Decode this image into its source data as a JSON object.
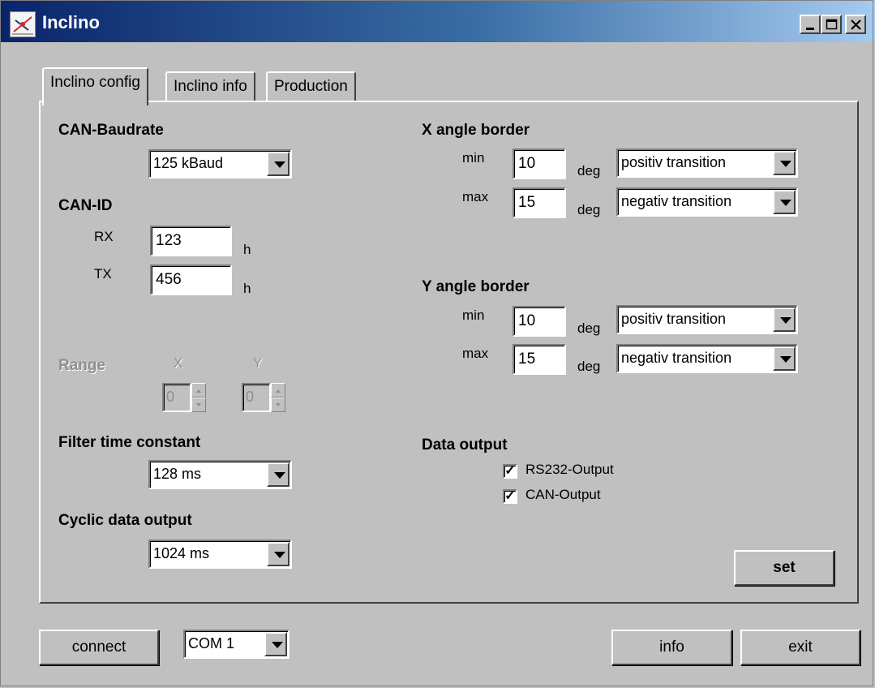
{
  "window": {
    "title": "Inclino",
    "app_icon": "inclino-logo-icon",
    "controls": [
      "minimize-icon",
      "maximize-icon",
      "close-icon"
    ]
  },
  "tabs": [
    {
      "label": "Inclino config",
      "active": true
    },
    {
      "label": "Inclino info",
      "active": false
    },
    {
      "label": "Production",
      "active": false
    }
  ],
  "can_baudrate": {
    "heading": "CAN-Baudrate",
    "value": "125 kBaud"
  },
  "can_id": {
    "heading": "CAN-ID",
    "rx_label": "RX",
    "rx_value": "123",
    "tx_label": "TX",
    "tx_value": "456",
    "unit": "h"
  },
  "range": {
    "heading": "Range",
    "x_label": "X",
    "y_label": "Y",
    "x_value": "0",
    "y_value": "0",
    "enabled": false
  },
  "filter": {
    "heading": "Filter time constant",
    "value": "128 ms"
  },
  "cyclic": {
    "heading": "Cyclic data output",
    "value": "1024 ms"
  },
  "x_border": {
    "heading": "X angle border",
    "min_label": "min",
    "min_value": "10",
    "max_label": "max",
    "max_value": "15",
    "unit": "deg",
    "min_transition": "positiv transition",
    "max_transition": "negativ transition"
  },
  "y_border": {
    "heading": "Y angle border",
    "min_label": "min",
    "min_value": "10",
    "max_label": "max",
    "max_value": "15",
    "unit": "deg",
    "min_transition": "positiv transition",
    "max_transition": "negativ transition"
  },
  "data_output": {
    "heading": "Data output",
    "rs232_label": "RS232-Output",
    "rs232_checked": true,
    "can_label": "CAN-Output",
    "can_checked": true,
    "check_mark": "✓"
  },
  "set_button": "set",
  "bottom": {
    "connect_label": "connect",
    "com_port": "COM 1",
    "info_label": "info",
    "exit_label": "exit"
  }
}
